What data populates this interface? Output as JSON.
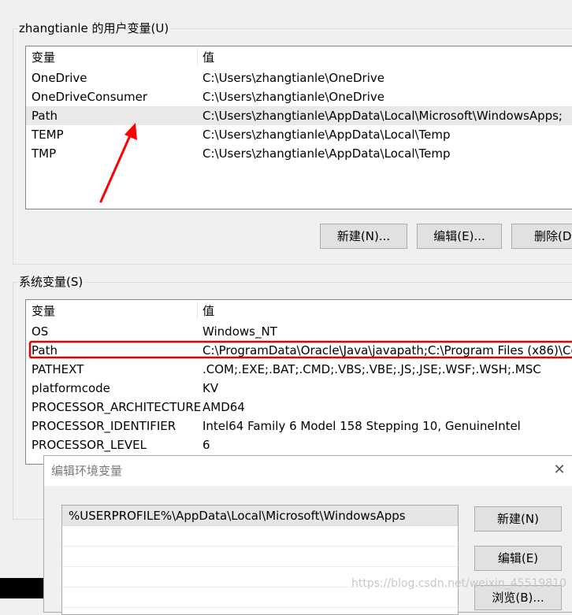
{
  "user_vars": {
    "group_title": "zhangtianle 的用户变量(U)",
    "columns": [
      "变量",
      "值"
    ],
    "rows": [
      {
        "name": "OneDrive",
        "value": "C:\\Users\\zhangtianle\\OneDrive"
      },
      {
        "name": "OneDriveConsumer",
        "value": "C:\\Users\\zhangtianle\\OneDrive"
      },
      {
        "name": "Path",
        "value": "C:\\Users\\zhangtianle\\AppData\\Local\\Microsoft\\WindowsApps;"
      },
      {
        "name": "TEMP",
        "value": "C:\\Users\\zhangtianle\\AppData\\Local\\Temp"
      },
      {
        "name": "TMP",
        "value": "C:\\Users\\zhangtianle\\AppData\\Local\\Temp"
      }
    ],
    "buttons": {
      "new": "新建(N)...",
      "edit": "编辑(E)...",
      "delete": "删除(D"
    }
  },
  "system_vars": {
    "group_title": "系统变量(S)",
    "columns": [
      "变量",
      "值"
    ],
    "rows": [
      {
        "name": "OS",
        "value": "Windows_NT"
      },
      {
        "name": "Path",
        "value": "C:\\ProgramData\\Oracle\\Java\\javapath;C:\\Program Files (x86)\\Co..."
      },
      {
        "name": "PATHEXT",
        "value": ".COM;.EXE;.BAT;.CMD;.VBS;.VBE;.JS;.JSE;.WSF;.WSH;.MSC"
      },
      {
        "name": "platformcode",
        "value": "KV"
      },
      {
        "name": "PROCESSOR_ARCHITECTURE",
        "value": "AMD64"
      },
      {
        "name": "PROCESSOR_IDENTIFIER",
        "value": "Intel64 Family 6 Model 158 Stepping 10, GenuineIntel"
      },
      {
        "name": "PROCESSOR_LEVEL",
        "value": "6"
      }
    ]
  },
  "edit_dialog": {
    "title": "编辑环境变量",
    "close_icon": "close-icon",
    "entries": [
      "%USERPROFILE%\\AppData\\Local\\Microsoft\\WindowsApps"
    ],
    "buttons": {
      "new": "新建(N)",
      "edit": "编辑(E)",
      "browse": "浏览(B)..."
    }
  },
  "annotations": {
    "arrow_color": "#ff0000",
    "highlight_color": "#e60000"
  },
  "watermark": "https://blog.csdn.net/weixin_45519810"
}
